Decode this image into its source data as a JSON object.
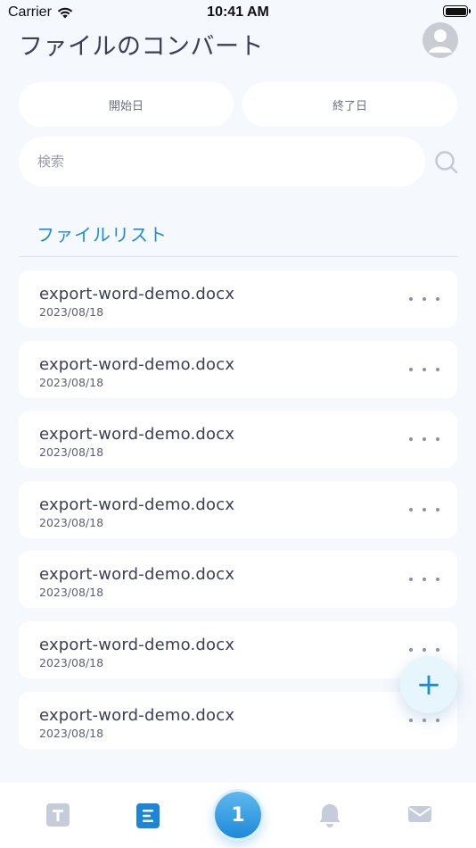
{
  "status_bar": {
    "carrier": "Carrier",
    "time": "10:41 AM"
  },
  "header": {
    "title": "ファイルのコンバート"
  },
  "filters": {
    "start_date_label": "開始日",
    "end_date_label": "終了日",
    "search_placeholder": "検索"
  },
  "file_list": {
    "title": "ファイルリスト",
    "items": [
      {
        "name": "export-word-demo.docx",
        "date": "2023/08/18"
      },
      {
        "name": "export-word-demo.docx",
        "date": "2023/08/18"
      },
      {
        "name": "export-word-demo.docx",
        "date": "2023/08/18"
      },
      {
        "name": "export-word-demo.docx",
        "date": "2023/08/18"
      },
      {
        "name": "export-word-demo.docx",
        "date": "2023/08/18"
      },
      {
        "name": "export-word-demo.docx",
        "date": "2023/08/18"
      },
      {
        "name": "export-word-demo.docx",
        "date": "2023/08/18"
      }
    ]
  },
  "fab": {
    "label": "+"
  },
  "tab_bar": {
    "center_badge": "1",
    "tabs": [
      {
        "icon": "text-icon",
        "active": false
      },
      {
        "icon": "document-icon",
        "active": true
      },
      {
        "icon": "bell-icon",
        "active": false
      },
      {
        "icon": "mail-icon",
        "active": false
      }
    ]
  },
  "colors": {
    "accent": "#1f8cd6",
    "background": "#f5f8fd",
    "card": "#ffffff",
    "text_primary": "#3b3e57",
    "inactive_icon": "#c6ccd9"
  }
}
